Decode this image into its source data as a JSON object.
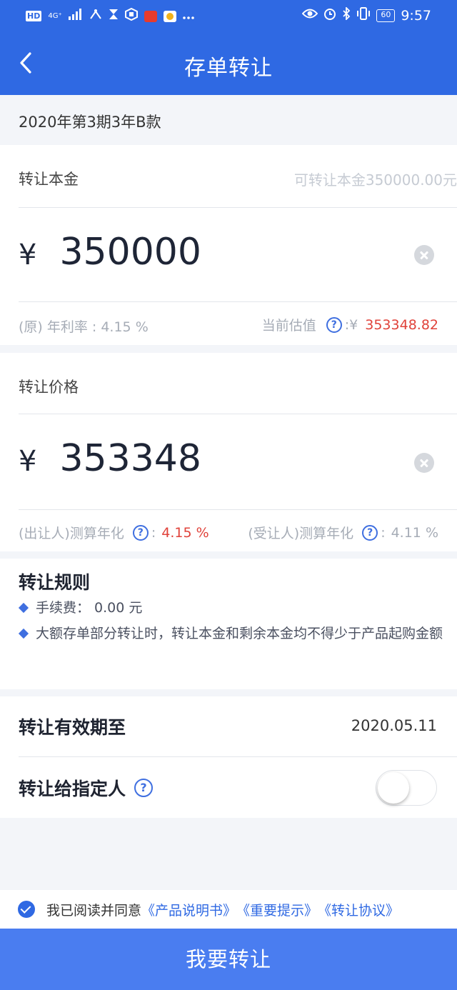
{
  "status_bar": {
    "left_hd": "HD",
    "left_network": "4G⁺",
    "battery": "60",
    "time": "9:57"
  },
  "nav": {
    "title": "存单转让"
  },
  "product": {
    "name": "2020年第3期3年B款"
  },
  "principal": {
    "label": "转让本金",
    "hint": "可转让本金350000.00元",
    "currency": "¥",
    "amount": "350000",
    "rate_label": "(原) 年利率 : 4.15 %",
    "valuation_label": "当前估值",
    "valuation_sep": ":¥",
    "valuation_value": "353348.82"
  },
  "price": {
    "label": "转让价格",
    "currency": "¥",
    "amount": "353348",
    "seller_label": "(出让人)测算年化",
    "seller_sep": ":",
    "seller_value": "4.15 %",
    "buyer_label": "(受让人)测算年化",
    "buyer_sep": ":",
    "buyer_value": "4.11 %"
  },
  "rules": {
    "title": "转让规则",
    "items": [
      "手续费： 0.00 元",
      "大额存单部分转让时，转让本金和剩余本金均不得少于产品起购金额"
    ]
  },
  "validity": {
    "label": "转让有效期至",
    "value": "2020.05.11"
  },
  "designate": {
    "label": "转让给指定人",
    "enabled": false
  },
  "agreement": {
    "prefix": "我已阅读并同意",
    "links": [
      "《产品说明书》",
      "《重要提示》",
      "《转让协议》"
    ]
  },
  "submit": {
    "label": "我要转让"
  },
  "colors": {
    "brand": "#2f69e3",
    "button": "#4a7df0",
    "highlight": "#e0423a"
  }
}
